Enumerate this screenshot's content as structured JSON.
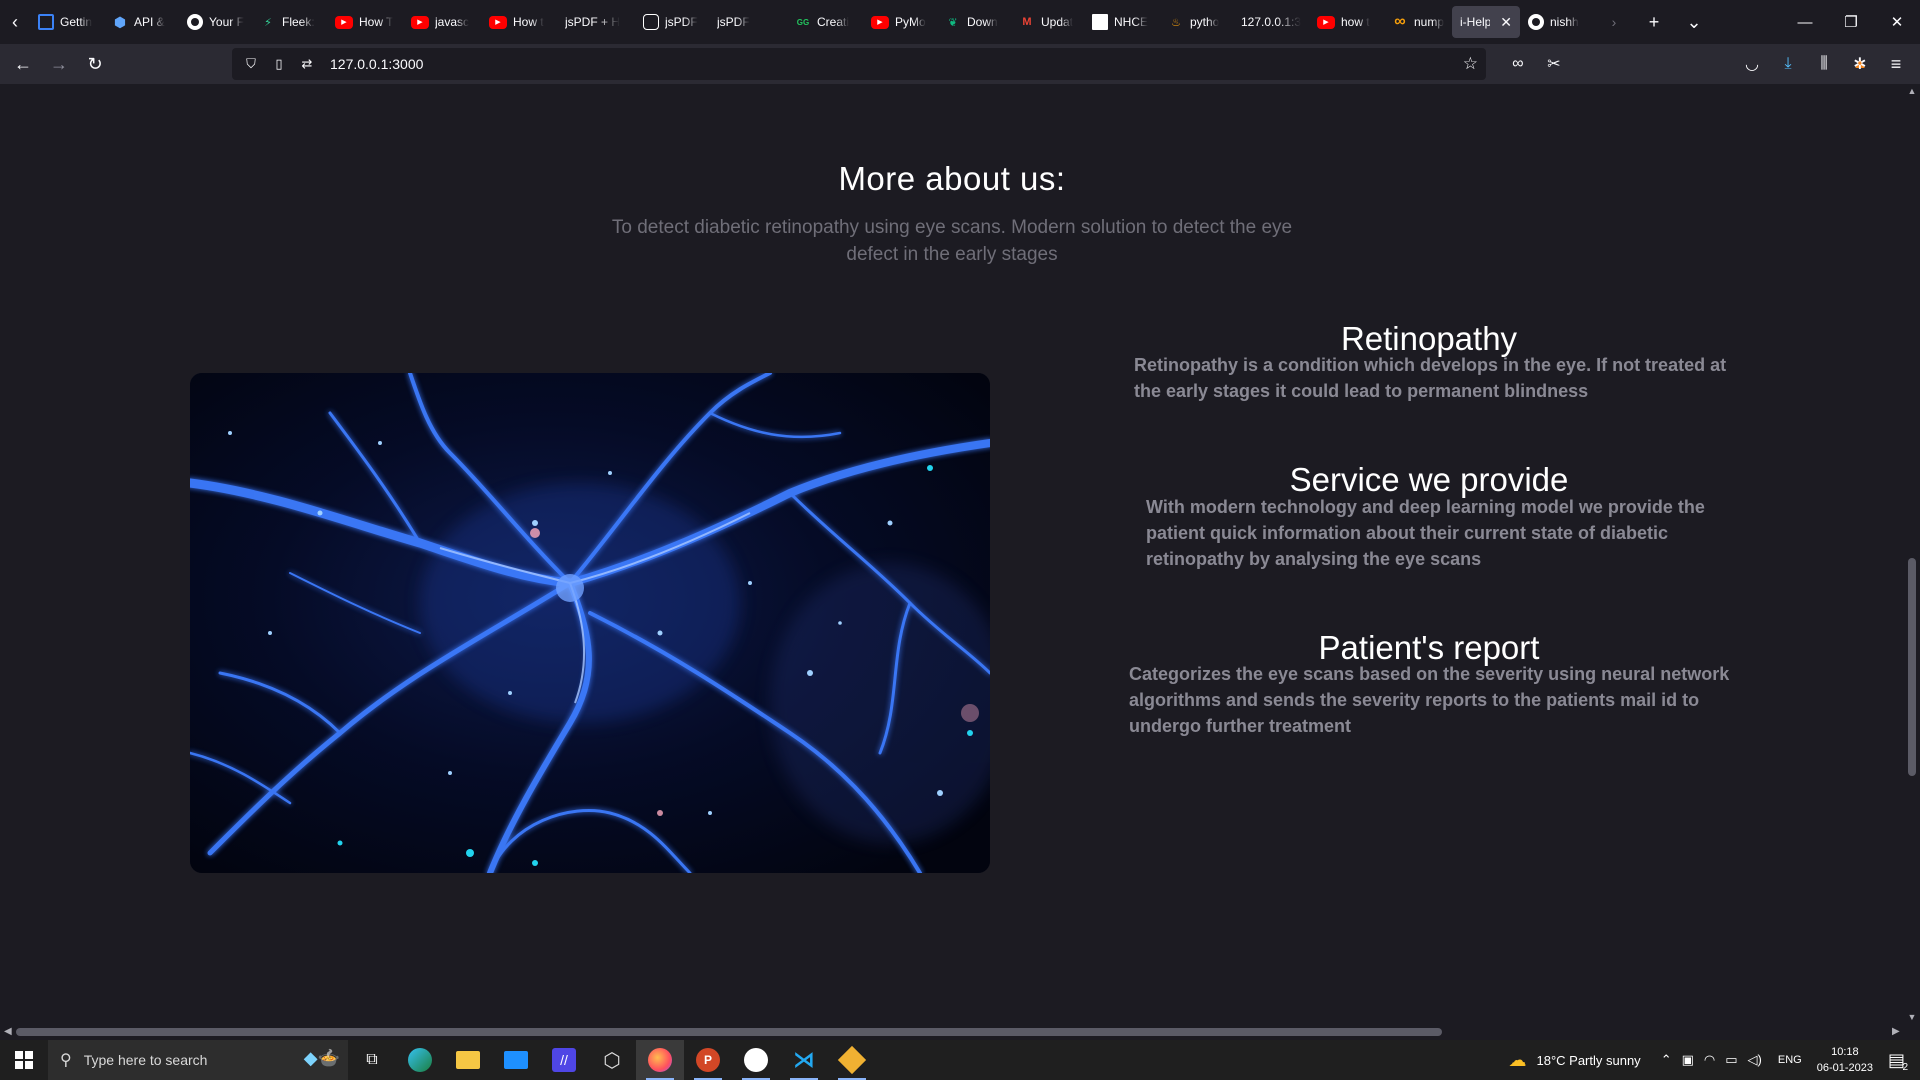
{
  "browser": {
    "tabs": [
      {
        "title": "Gettin",
        "icon": "blue-square-icon",
        "color": "#3b82f6"
      },
      {
        "title": "API &",
        "icon": "hexagon-icon",
        "color": "#60a5fa"
      },
      {
        "title": "Your F",
        "icon": "github-icon",
        "color": "#ffffff"
      },
      {
        "title": "Fleek:",
        "icon": "fleek-icon",
        "color": "#34d399"
      },
      {
        "title": "How T",
        "icon": "youtube-icon",
        "color": "#ff0000"
      },
      {
        "title": "javasc",
        "icon": "youtube-icon",
        "color": "#ff0000"
      },
      {
        "title": "How t",
        "icon": "youtube-icon",
        "color": "#ff0000"
      },
      {
        "title": "jsPDF + H",
        "icon": "blank-icon",
        "color": "#1c1b22"
      },
      {
        "title": "jsPDF",
        "icon": "openai-icon",
        "color": "#ffffff"
      },
      {
        "title": "jsPDF",
        "icon": "blank-icon",
        "color": "#1c1b22"
      },
      {
        "title": "Creati",
        "icon": "gg-icon",
        "color": "#22c55e"
      },
      {
        "title": "PyMo",
        "icon": "youtube-icon",
        "color": "#ff0000"
      },
      {
        "title": "Down",
        "icon": "leaf-icon",
        "color": "#10b981"
      },
      {
        "title": "Updat",
        "icon": "gmail-icon",
        "color": "#ea4335"
      },
      {
        "title": "NHCE",
        "icon": "document-icon",
        "color": "#ffffff"
      },
      {
        "title": "pytho",
        "icon": "flame-icon",
        "color": "#f59e0b"
      },
      {
        "title": "127.0.0.1:3",
        "icon": "blank-icon",
        "color": "#1c1b22"
      },
      {
        "title": "how t",
        "icon": "youtube-icon",
        "color": "#ff0000"
      },
      {
        "title": "nump",
        "icon": "infinity-icon",
        "color": "#f59e0b"
      },
      {
        "title": "i-Help",
        "icon": "blank-icon",
        "color": "#42414d",
        "active": true
      },
      {
        "title": "nishh",
        "icon": "github-icon",
        "color": "#ffffff"
      }
    ],
    "url": "127.0.0.1:3000"
  },
  "page": {
    "section_title": "More about us:",
    "section_subtitle": "To detect diabetic retinopathy using eye scans. Modern solution to detect the eye defect in the early stages",
    "features": [
      {
        "title": "Retinopathy",
        "text": "Retinopathy is a condition which develops in the eye. If not treated at the early stages it could lead to permanent blindness"
      },
      {
        "title": "Service we provide",
        "text": "With modern technology and deep learning model we provide the patient quick information about their current state of diabetic retinopathy by analysing the eye scans"
      },
      {
        "title": "Patient's report",
        "text": "Categorizes the eye scans based on the severity using neural network algorithms and sends the severity reports to the patients mail id to undergo further treatment"
      }
    ]
  },
  "taskbar": {
    "search_placeholder": "Type here to search",
    "weather": "18°C  Partly sunny",
    "language": "ENG",
    "time": "10:18",
    "date": "06-01-2023",
    "notifications": "2"
  }
}
